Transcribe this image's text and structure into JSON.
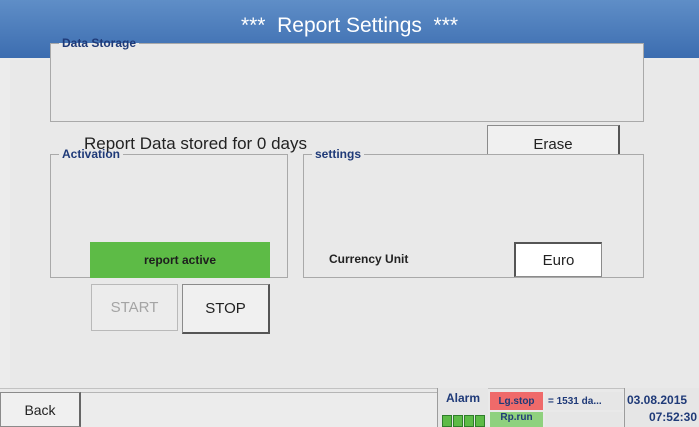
{
  "title": "***  Report Settings  ***",
  "data_storage": {
    "legend": "Data Storage",
    "status_text": "Report Data stored for 0 days",
    "erase_label": "Erase"
  },
  "activation": {
    "legend": "Activation",
    "status": "report active",
    "status_color": "#5dbb46",
    "start_label": "START",
    "stop_label": "STOP"
  },
  "settings": {
    "legend": "settings",
    "currency_label": "Currency Unit",
    "currency_value": "Euro"
  },
  "footer": {
    "back_label": "Back",
    "alarm_label": "Alarm",
    "logger_status": "Lg.stop",
    "logger_status_color": "#ef6a6a",
    "logger_days": "= 1531 da...",
    "report_status": "Rp.run",
    "report_status_color": "#8fd17e",
    "date": "03.08.2015",
    "time": "07:52:30"
  }
}
